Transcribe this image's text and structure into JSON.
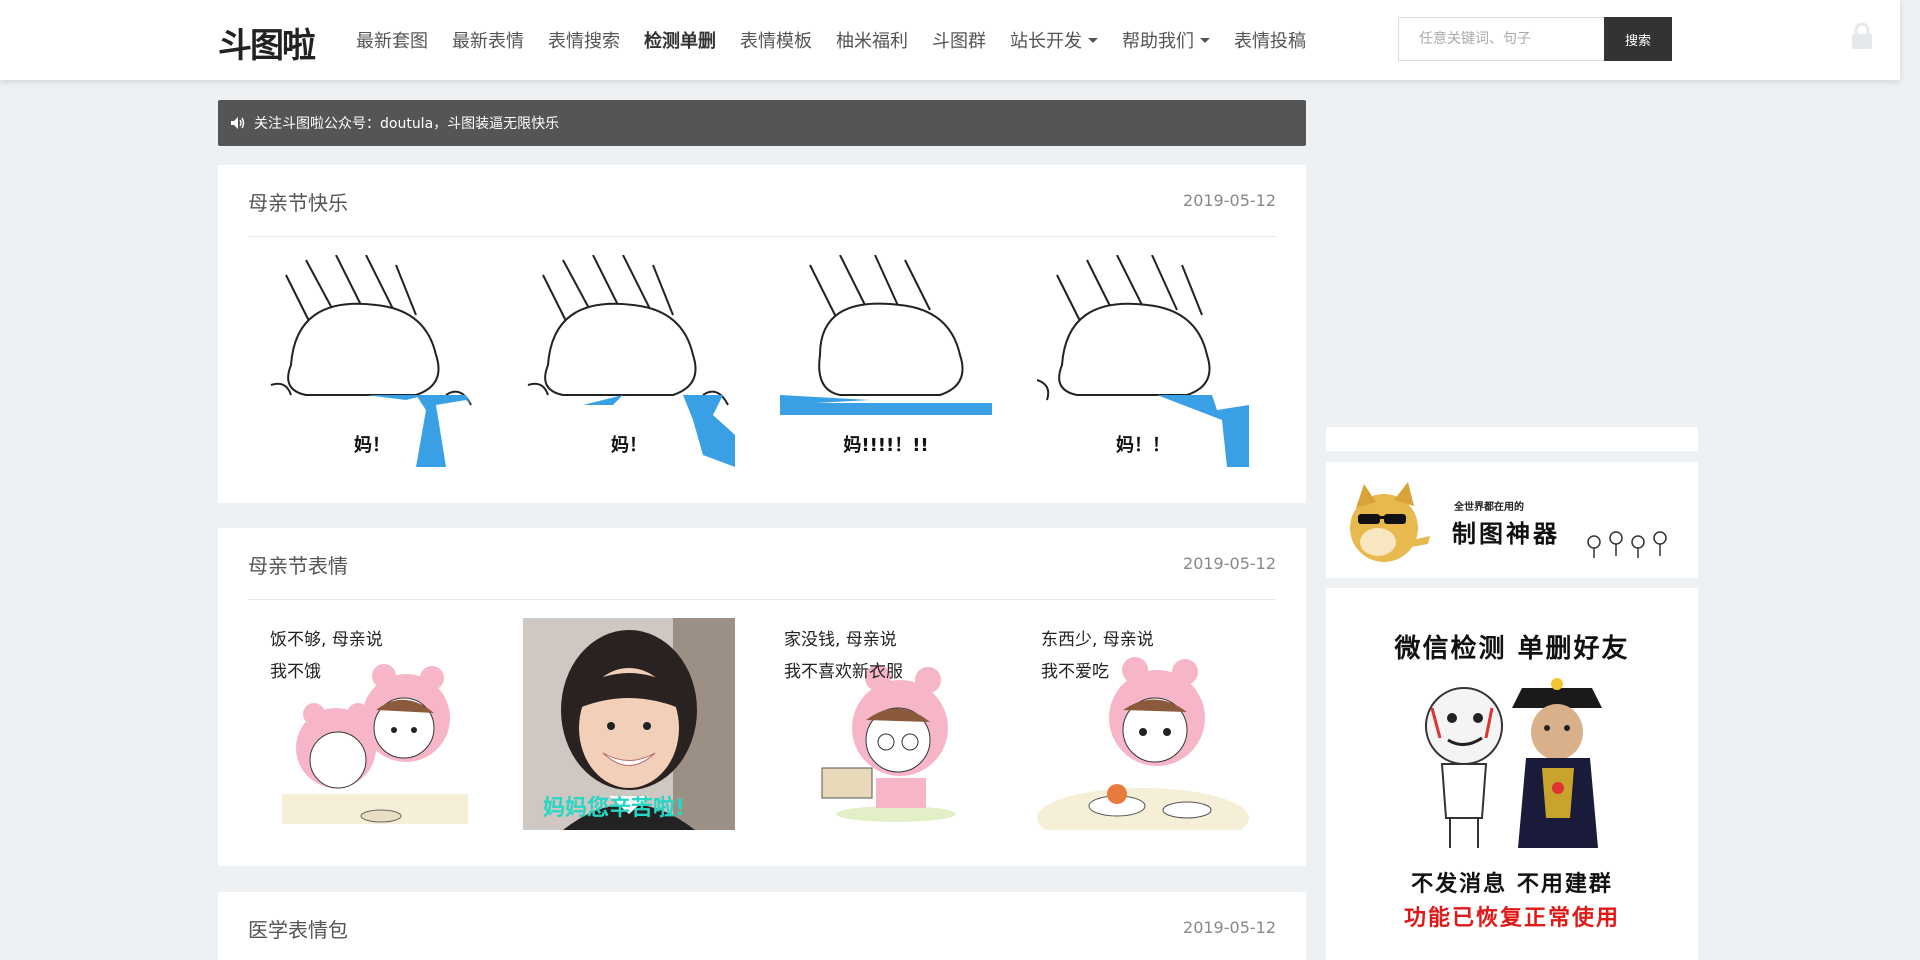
{
  "nav": {
    "logo": "斗图啦",
    "items": [
      {
        "label": "最新套图"
      },
      {
        "label": "最新表情"
      },
      {
        "label": "表情搜索"
      },
      {
        "label": "检测单删",
        "active": true
      },
      {
        "label": "表情模板"
      },
      {
        "label": "柚米福利"
      },
      {
        "label": "斗图群"
      },
      {
        "label": "站长开发",
        "dropdown": true
      },
      {
        "label": "帮助我们",
        "dropdown": true
      },
      {
        "label": "表情投稿"
      }
    ],
    "search_placeholder": "任意关键词、句子",
    "search_button": "搜索"
  },
  "notice": {
    "text": "关注斗图啦公众号：doutula，斗图装逼无限快乐"
  },
  "posts": [
    {
      "title": "母亲节快乐",
      "date": "2019-05-12",
      "captions": [
        "妈！",
        "妈！",
        "妈!!!!！!!",
        "妈！！"
      ]
    },
    {
      "title": "母亲节表情",
      "date": "2019-05-12",
      "captions": [
        "饭不够, 母亲说\n我不饿",
        "妈妈您辛苦啦!",
        "家没钱, 母亲说\n我不喜欢新衣服",
        "东西少, 母亲说\n我不爱吃"
      ]
    },
    {
      "title": "医学表情包",
      "date": "2019-05-12"
    }
  ],
  "sidebar": {
    "ad1_small": "全世界都在用的",
    "ad1_big": "制图神器",
    "ad2_title": "微信检测  单删好友",
    "ad2_line1": "不发消息   不用建群",
    "ad2_line2": "功能已恢复正常使用"
  },
  "colors": {
    "page_bg": "#eef1f4",
    "notice_bg": "#555555",
    "search_btn_bg": "#333333",
    "water_blue": "#3aa0e6",
    "pink": "#f7b6c8",
    "ad_red": "#e01818"
  }
}
